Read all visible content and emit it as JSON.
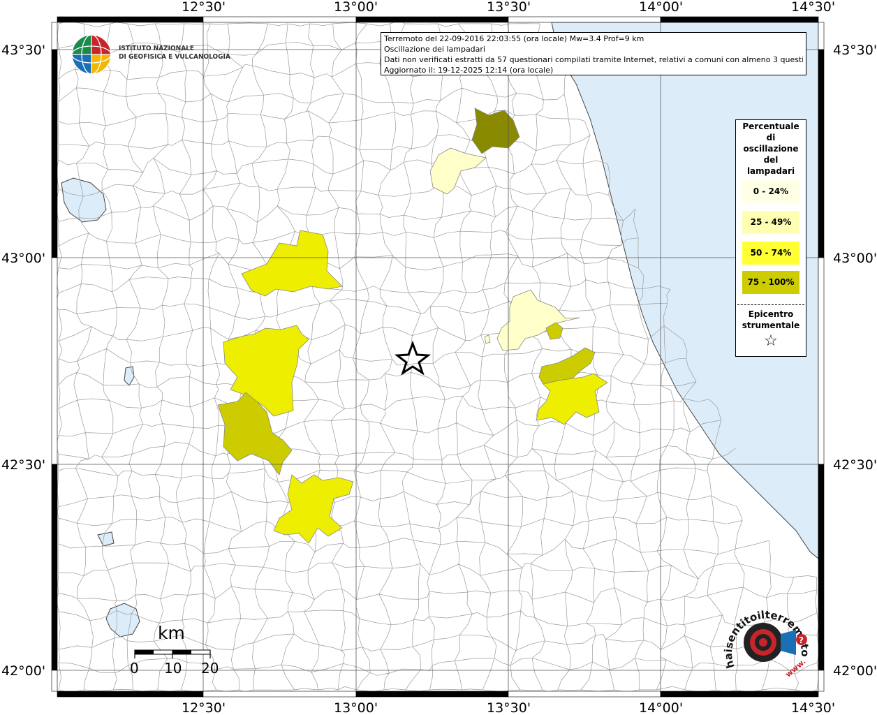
{
  "header": {
    "line1": "Terremoto del 22-09-2016 22:03:55 (ora locale) Mw=3.4 Prof=9 km",
    "line2": "Oscillazione dei lampadari",
    "line3": "Dati non verificati estratti da 57 questionari compilati tramite Internet, relativi a comuni con almeno 3 questionari.",
    "line4": "Aggiornato il: 19-12-2025 12:14 (ora locale)"
  },
  "institute": {
    "line1": "ISTITUTO NAZIONALE",
    "line2": "DI GEOFISICA E VULCANOLOGIA"
  },
  "axes": {
    "lon_labels": [
      "12°30'",
      "13°00'",
      "13°30'",
      "14°00'",
      "14°30'"
    ],
    "lat_labels": [
      "43°30'",
      "43°00'",
      "42°30'",
      "42°00'"
    ],
    "lon_range": [
      "12°12'",
      "14°30'"
    ],
    "lat_range": [
      "41°58'",
      "43°34'"
    ]
  },
  "legend": {
    "title": [
      "Percentuale",
      "di",
      "oscillazione",
      "del",
      "lampadari"
    ],
    "classes": [
      {
        "label": "0 - 24%",
        "color": "#ffffe6"
      },
      {
        "label": "25 - 49%",
        "color": "#ffffb3"
      },
      {
        "label": "50 - 74%",
        "color": "#ffff33"
      },
      {
        "label": "75 - 100%",
        "color": "#cccc00"
      }
    ],
    "epicenter_label": [
      "Epicentro",
      "strumentale"
    ],
    "epicenter_symbol": "☆"
  },
  "scale_bar": {
    "unit": "km",
    "ticks": [
      "0",
      "10",
      "20"
    ]
  },
  "watermark": {
    "text": "haisentitoilterremoto.it",
    "url": "www."
  },
  "colors": {
    "sea": "#dcedf9",
    "lake": "#dcedf9",
    "boundary": "#9a9a9a",
    "grid": "#555555",
    "class_0_24": "#ffffc9",
    "class_25_49": "#ffffc9",
    "class_50_74": "#eeee00",
    "class_75_100": "#cccc00",
    "class_dark": "#8a8a00"
  }
}
